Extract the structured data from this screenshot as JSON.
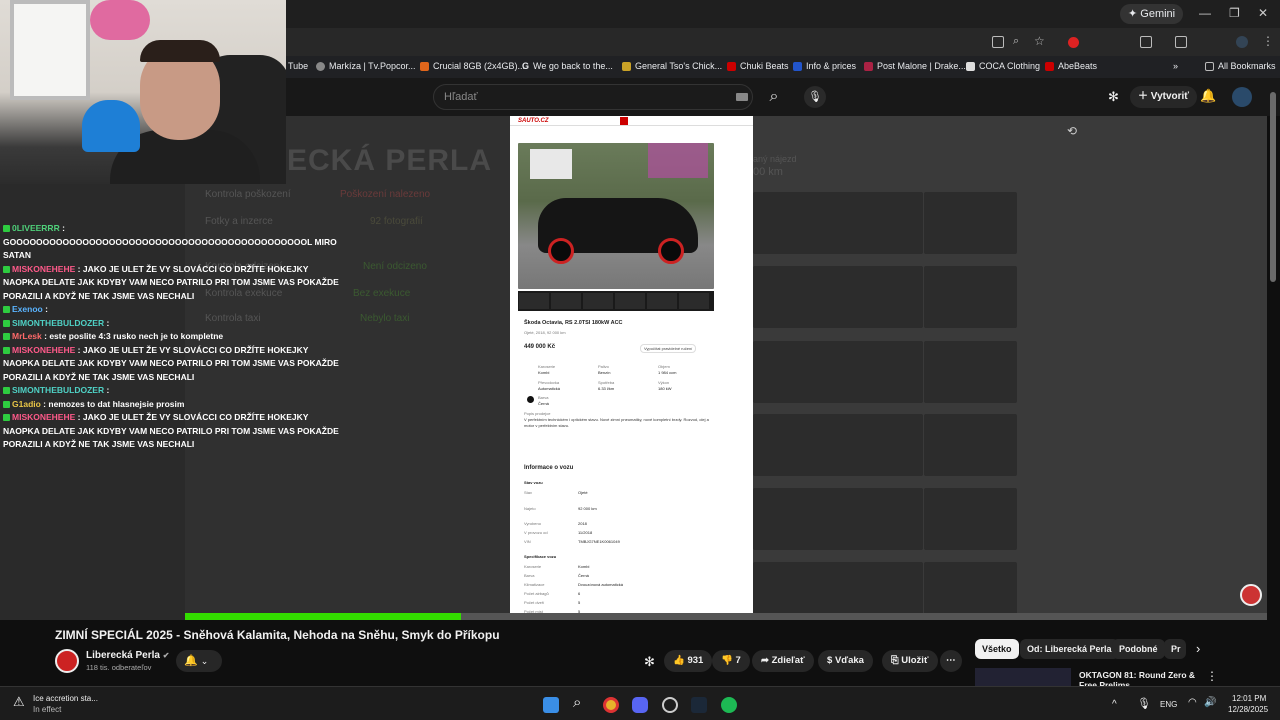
{
  "browser": {
    "gemini_label": "Gemini",
    "search_placeholder": "Hľadať",
    "bookmarks": [
      {
        "label": "Tube",
        "color": "#cc0000"
      },
      {
        "label": "Markíza | Tv.Popcor...",
        "color": "#888888"
      },
      {
        "label": "Crucial 8GB (2x4GB)...",
        "color": "#e0661b"
      },
      {
        "label": "We go back to the...",
        "color": "#ffffff"
      },
      {
        "label": "General Tso's Chick...",
        "color": "#c9a227"
      },
      {
        "label": "Chuki Beats",
        "color": "#cc0000"
      },
      {
        "label": "Info & prices",
        "color": "#2255cc"
      },
      {
        "label": "Post Malone | Drake...",
        "color": "#aa2244"
      },
      {
        "label": "COCA Clothing",
        "color": "#dddddd"
      },
      {
        "label": "AbeBeats",
        "color": "#cc0000"
      }
    ],
    "all_bookmarks": "All Bookmarks"
  },
  "youtube": {
    "create_label": "Vytvoriť",
    "video_title": "ZIMNÍ SPECIÁL 2025 - Sněhová Kalamita, Nehoda na Sněhu, Smyk do Příkopu",
    "channel_name": "Liberecká Perla",
    "subscribers": "118 tis. odberateľov",
    "likes": "931",
    "dislikes": "7",
    "share": "Zdieľať",
    "thanks": "Vďaka",
    "save": "Uložiť",
    "progress_fraction": 0.255,
    "chips": [
      "Všetko",
      "Od: Liberecká Perla",
      "Podobné",
      "Pr"
    ],
    "rec_title": "OKTAGON 81: Round Zero &",
    "rec_title2": "Free Prelims"
  },
  "video_bg": {
    "big_title": "ECKÁ PERLA",
    "rows": [
      {
        "label": "Kontrola poškození",
        "value": "Poškození nalezeno"
      },
      {
        "label": "Fotky a inzerce",
        "value": "92 fotografií"
      },
      {
        "label": "Kontrola odcizení",
        "value": "Není odcizeno"
      },
      {
        "label": "Kontrola exekuce",
        "value": "Bez exekuce"
      },
      {
        "label": "Kontrola taxi",
        "value": "Nebylo taxi"
      }
    ],
    "mileage_label": "aný nájezd",
    "mileage_value": "00 km"
  },
  "listing": {
    "logo": "SAUTO.CZ",
    "title": "Škoda Octavia, RS 2.0TSI 180kW ACC",
    "subtitle": "Ojeté, 2018, 92 000 km",
    "price": "449 000 Kč",
    "calc_btn": "Vypočítat pravidelné ručení",
    "specs": [
      {
        "k": "Karoserie",
        "v": "Kombi"
      },
      {
        "k": "Palivo",
        "v": "Benzín"
      },
      {
        "k": "Objem",
        "v": "1 984 ccm"
      },
      {
        "k": "Převodovka",
        "v": "Automatická"
      },
      {
        "k": "Spotřeba",
        "v": "6.33 l/km"
      },
      {
        "k": "Výkon",
        "v": "180 kW"
      },
      {
        "k": "Barva",
        "v": "Černá"
      }
    ],
    "desc_head": "Popis prodejce",
    "desc": "V perfektním technickém i optickém stavu. Nové zimní pneumatiky, nové kompletní brzdy. Rozvod, olej a motor v perfektním stavu.",
    "info_head": "Informace o vozu",
    "state_head": "Stav vozu",
    "state_rows": [
      {
        "k": "Stav",
        "v": "Ojeté"
      },
      {
        "k": "Najeto",
        "v": "92 000 km"
      },
      {
        "k": "Vyrobeno",
        "v": "2018"
      },
      {
        "k": "V provozu od",
        "v": "11/2018"
      },
      {
        "k": "VIN",
        "v": "TMBJG7NE1K0061049"
      }
    ],
    "spec_head": "Specifikace vozu",
    "spec_rows": [
      {
        "k": "Karoserie",
        "v": "Kombi"
      },
      {
        "k": "Barva",
        "v": "Černá"
      },
      {
        "k": "Klimatizace",
        "v": "Dvouzónová automatická"
      },
      {
        "k": "Počet airbagů",
        "v": "6"
      },
      {
        "k": "Počet dveří",
        "v": "5"
      },
      {
        "k": "Počet míst",
        "v": "5"
      }
    ]
  },
  "chat": [
    {
      "user": "0LIVEERRR",
      "color": "#4fd17a",
      "text": "GOOOOOOOOOOOOOOOOOOOOOOOOOOOOOOOOOOOOOOOOOOOOOL MIRO SATAN"
    },
    {
      "user": "MISKONEHEHE",
      "color": "#ff5a8a",
      "text": "JAKO JE ULET ŽE VY SLOVÁCCI CO DRŽÍTE HOKEJKY NAOPKA DELATE JAK KDYBY VAM NECO PATRILO PRI TOM JSME VAS POKAŽDE PORAZILI A KDYŽ NE TAK JSME VAS NECHALI"
    },
    {
      "user": "Exenoo",
      "color": "#5ab4ff",
      "text": ""
    },
    {
      "user": "SIMONTHEBULDOZER",
      "color": "#4fd1c5",
      "text": ""
    },
    {
      "user": "MrLesk",
      "color": "#ff6a6a",
      "text": "este poslite 4:3 rusko nech je to kompletne"
    },
    {
      "user": "MISKONEHEHE",
      "color": "#ff5a8a",
      "text": "JAKO JE ULET ŽE VY SLOVÁCCI CO DRŽÍTE HOKEJKY NAOPKA DELATE JAK KDYBY VAM NECO PATRILO PRI TOM JSME VAS POKAŽDE PORAZILI A KDYŽ NE TAK JSME VAS NECHALI"
    },
    {
      "user": "SIMONTHEBULDOZER",
      "color": "#4fd1c5",
      "text": ""
    },
    {
      "user": "G1adio",
      "color": "#e8c547",
      "text": "nemozes to dat hlasnejsie prosim"
    },
    {
      "user": "MISKONEHEHE",
      "color": "#ff5a8a",
      "text": "JAKO JE ULET ŽE VY SLOVÁCCI CO DRŽÍTE HOKEJKY NAOPKA DELATE JAK KDYBY VAM NECO PATRILO PRI TOM JSME VAS POKAŽDE PORAZILI A KDYŽ NE TAK JSME VAS NECHALI"
    }
  ],
  "taskbar": {
    "weather_line1": "Ice accretion sta...",
    "weather_line2": "In effect",
    "lang": "ENG",
    "time": "12:01 PM",
    "date": "12/28/2025"
  },
  "icons": [
    "search-icon",
    "mic-icon",
    "bell-icon",
    "like-icon",
    "dislike-icon",
    "share-icon",
    "save-icon",
    "more-icon",
    "windows-start-icon",
    "chrome-icon",
    "discord-icon",
    "steam-icon",
    "spotify-icon"
  ]
}
